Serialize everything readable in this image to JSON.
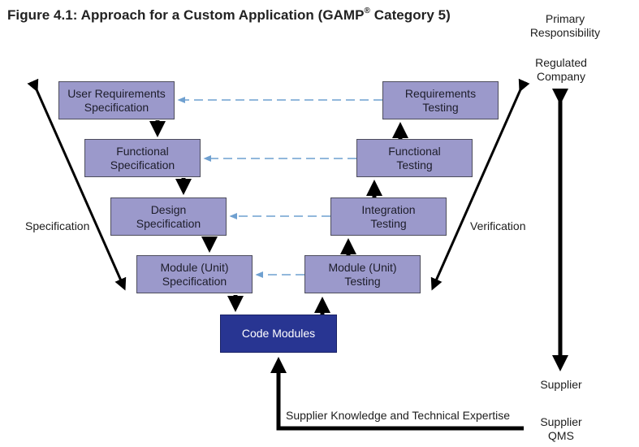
{
  "figure": {
    "title_main": "Figure 4.1: Approach for a Custom Application (GAMP",
    "title_sup": "®",
    "title_end": " Category 5)"
  },
  "specification_side": {
    "label": "Specification",
    "boxes": [
      {
        "line1": "User Requirements",
        "line2": "Specification"
      },
      {
        "line1": "Functional",
        "line2": "Specification"
      },
      {
        "line1": "Design",
        "line2": "Specification"
      },
      {
        "line1": "Module (Unit)",
        "line2": "Specification"
      }
    ]
  },
  "verification_side": {
    "label": "Verification",
    "boxes": [
      {
        "line1": "Requirements",
        "line2": "Testing"
      },
      {
        "line1": "Functional",
        "line2": "Testing"
      },
      {
        "line1": "Integration",
        "line2": "Testing"
      },
      {
        "line1": "Module (Unit)",
        "line2": "Testing"
      }
    ]
  },
  "code_modules": {
    "label": "Code Modules"
  },
  "responsibility": {
    "header_line1": "Primary",
    "header_line2": "Responsibility",
    "top_line1": "Regulated",
    "top_line2": "Company",
    "bottom": "Supplier"
  },
  "supplier_input": {
    "label": "Supplier Knowledge and Technical Expertise",
    "qms_line1": "Supplier",
    "qms_line2": "QMS"
  },
  "colors": {
    "box_fill": "#9b99cb",
    "code_fill": "#283592",
    "dashed_link": "#6fa0d0",
    "arrow": "#000000"
  }
}
